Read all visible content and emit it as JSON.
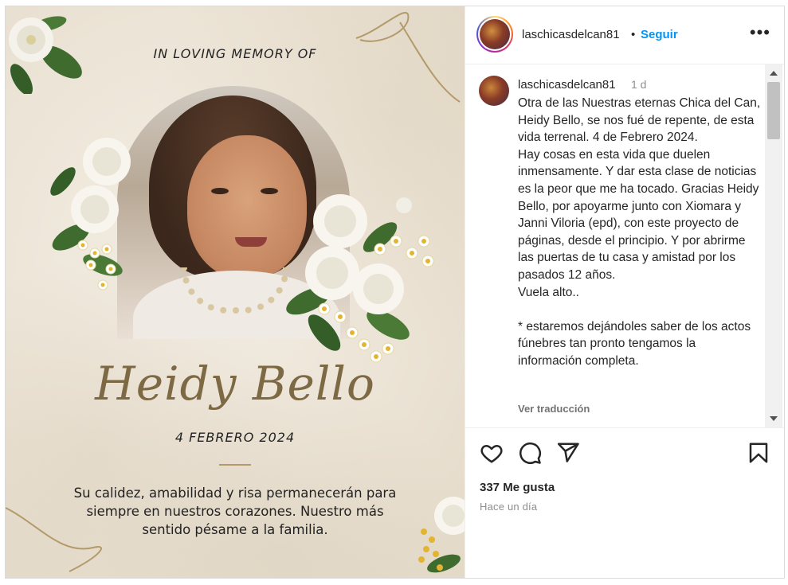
{
  "memorial": {
    "heading": "IN LOVING MEMORY OF",
    "name": "Heidy Bello",
    "date": "4 FEBRERO 2024",
    "message": "Su calidez, amabilidad y risa permanecerán para siempre en nuestros corazones. Nuestro más sentido pésame a la familia."
  },
  "header": {
    "username": "laschicasdelcan81",
    "separator": "•",
    "follow_label": "Seguir",
    "more_label": "•••"
  },
  "caption": {
    "username": "laschicasdelcan81",
    "time": "1 d",
    "text": "Otra de las Nuestras eternas Chica del Can, Heidy Bello, se nos fué de repente, de esta vida terrenal. 4 de Febrero 2024.\nHay cosas en esta vida que duelen inmensamente. Y dar esta clase de noticias es la peor que me ha tocado. Gracias Heidy Bello, por apoyarme junto con Xiomara y Janni Viloria (epd), con este proyecto de páginas, desde el principio. Y por abrirme las puertas de tu casa y amistad por los pasados 12 años.\nVuela alto..\n\n* estaremos dejándoles saber de los actos fúnebres tan pronto tengamos la información completa.",
    "translate_label": "Ver traducción"
  },
  "actions": {
    "icons": [
      "heart-icon",
      "comment-icon",
      "share-icon",
      "bookmark-icon"
    ],
    "likes": "337 Me gusta",
    "posted": "Hace un día"
  },
  "colors": {
    "accent_blue": "#0095f6",
    "script_gold": "#7d6a45",
    "muted_text": "#8e8e8e"
  }
}
